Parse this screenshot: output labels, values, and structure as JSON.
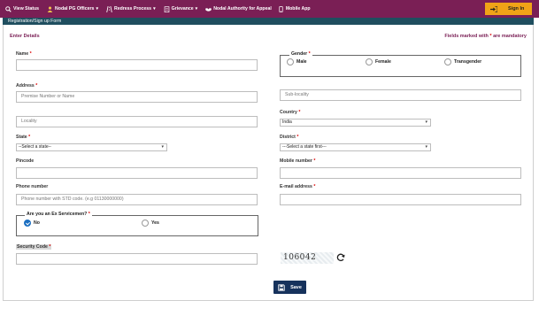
{
  "nav": {
    "items": [
      {
        "label": "View Status",
        "icon": "search-icon",
        "caret": false
      },
      {
        "label": "Nodal PG Officers",
        "icon": "user-icon",
        "caret": true
      },
      {
        "label": "Redress Process",
        "icon": "road-icon",
        "caret": true
      },
      {
        "label": "Grievance",
        "icon": "clipboard-icon",
        "caret": true
      },
      {
        "label": "Nodal Authority for Appeal",
        "icon": "handshake-icon",
        "caret": false
      },
      {
        "label": "Mobile App",
        "icon": "mobile-icon",
        "caret": false
      }
    ],
    "signin_label": "Sign In",
    "signin_color": "#f0a317",
    "bar_color": "#7a1f55"
  },
  "page": {
    "section_title": "Registration/Sign up Form",
    "enter_details": "Enter Details",
    "mandatory_note_prefix": "Fields marked with ",
    "mandatory_star": "*",
    "mandatory_note_suffix": " are mandatory"
  },
  "form": {
    "name_label": "Name",
    "gender_label": "Gender",
    "gender_options": [
      "Male",
      "Female",
      "Transgender"
    ],
    "address_label": "Address",
    "address_placeholder": "Premise Number or Name",
    "sublocality_placeholder": "Sub-locality",
    "locality_placeholder": "Locality",
    "country_label": "Country",
    "country_value": "India",
    "state_label": "State",
    "state_value": "--Select a state--",
    "district_label": "District",
    "district_value": "---Select a state first---",
    "pincode_label": "Pincode",
    "mobile_label": "Mobile number",
    "phone_label": "Phone number",
    "phone_placeholder": "Phone number with STD code. (e.g 01130000000)",
    "email_label": "E-mail address",
    "exs_label": "Are you an Ex Servicemen?",
    "exs_options": [
      {
        "label": "No",
        "selected": true
      },
      {
        "label": "Yes",
        "selected": false
      }
    ],
    "security_label": "Security Code",
    "captcha_text": "106042",
    "save_label": "Save",
    "req": "*"
  }
}
